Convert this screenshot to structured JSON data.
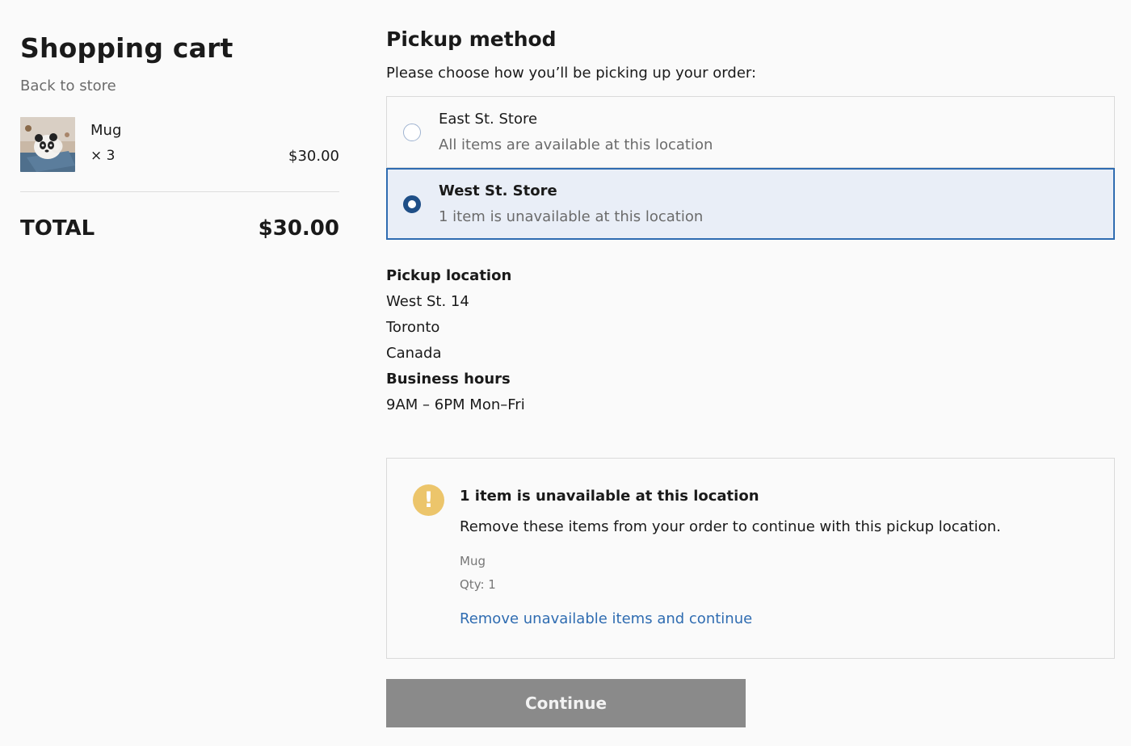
{
  "cart": {
    "title": "Shopping cart",
    "back_link": "Back to store",
    "items": [
      {
        "name": "Mug",
        "quantity": "× 3",
        "price": "$30.00",
        "image": "panda-mug-thumbnail"
      }
    ],
    "total_label": "TOTAL",
    "total_value": "$30.00"
  },
  "pickup": {
    "title": "Pickup method",
    "subtitle": "Please choose how you’ll be picking up your order:",
    "options": [
      {
        "name": "East St. Store",
        "description": "All items are available at this location",
        "selected": false
      },
      {
        "name": "West St. Store",
        "description": "1 item is unavailable at this location",
        "selected": true
      }
    ],
    "location": {
      "heading": "Pickup location",
      "street": "West St. 14",
      "city": "Toronto",
      "country": "Canada",
      "hours_heading": "Business hours",
      "hours": "9AM – 6PM Mon–Fri"
    },
    "alert": {
      "icon": "warning-exclamation-icon",
      "icon_glyph": "!",
      "title": "1 item is unavailable at this location",
      "text": "Remove these items from your order to continue with this pickup location.",
      "item_name": "Mug",
      "item_qty": "Qty: 1",
      "link": "Remove unavailable items and continue"
    },
    "continue_label": "Continue"
  },
  "colors": {
    "accent": "#2f6cb1",
    "selected_bg": "#e9eef7",
    "radio_selected": "#1f4f87",
    "warning": "#ecc56b",
    "button_disabled": "#8a8a8a"
  }
}
